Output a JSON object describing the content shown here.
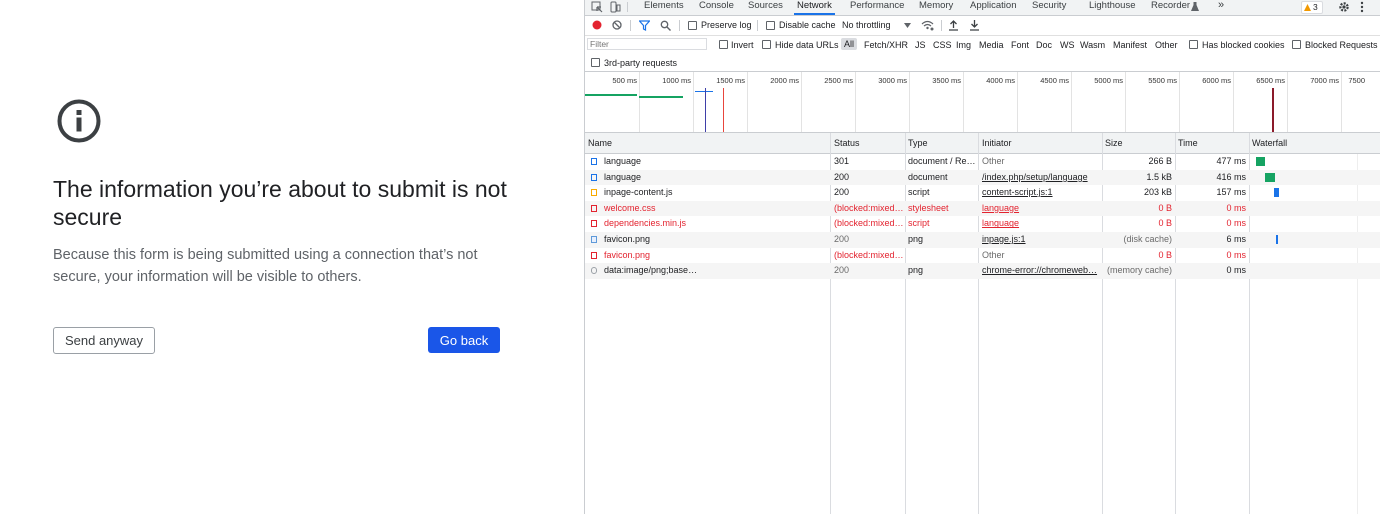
{
  "interstitial": {
    "heading": "The information you’re about to submit is not secure",
    "description": "Because this form is being submitted using a connection that’s not secure, your information will be visible to others.",
    "send_anyway_label": "Send anyway",
    "go_back_label": "Go back",
    "accent_color": "#1a56e8",
    "icon": "info-icon"
  },
  "devtools": {
    "tabs": [
      "Elements",
      "Console",
      "Sources",
      "Network",
      "Performance",
      "Memory",
      "Application",
      "Security",
      "Lighthouse",
      "Recorder"
    ],
    "active_tab": "Network",
    "more_tabs": "»",
    "warning_count": "3",
    "toolbar": {
      "preserve_log": "Preserve log",
      "disable_cache": "Disable cache",
      "throttling": "No throttling"
    },
    "filter": {
      "placeholder": "Filter",
      "invert": "Invert",
      "hide_data_urls": "Hide data URLs",
      "types": [
        "All",
        "Fetch/XHR",
        "JS",
        "CSS",
        "Img",
        "Media",
        "Font",
        "Doc",
        "WS",
        "Wasm",
        "Manifest",
        "Other"
      ],
      "has_blocked_cookies": "Has blocked cookies",
      "blocked_requests": "Blocked Requests",
      "third_party": "3rd-party requests"
    },
    "timeline_ticks": [
      "500 ms",
      "1000 ms",
      "1500 ms",
      "2000 ms",
      "2500 ms",
      "3000 ms",
      "3500 ms",
      "4000 ms",
      "4500 ms",
      "5000 ms",
      "5500 ms",
      "6000 ms",
      "6500 ms",
      "7000 ms",
      "7500"
    ],
    "columns": [
      "Name",
      "Status",
      "Type",
      "Initiator",
      "Size",
      "Time",
      "Waterfall"
    ],
    "requests": [
      {
        "name": "language",
        "status": "301",
        "type": "document / Re…",
        "initiator": "Other",
        "size": "266 B",
        "time": "477 ms"
      },
      {
        "name": "language",
        "status": "200",
        "type": "document",
        "initiator": "/index.php/setup/language",
        "size": "1.5 kB",
        "time": "416 ms"
      },
      {
        "name": "inpage-content.js",
        "status": "200",
        "type": "script",
        "initiator": "content-script.js:1",
        "size": "203 kB",
        "time": "157 ms"
      },
      {
        "name": "welcome.css",
        "status": "(blocked:mixed…",
        "type": "stylesheet",
        "initiator": "language",
        "size": "0 B",
        "time": "0 ms"
      },
      {
        "name": "dependencies.min.js",
        "status": "(blocked:mixed…",
        "type": "script",
        "initiator": "language",
        "size": "0 B",
        "time": "0 ms"
      },
      {
        "name": "favicon.png",
        "status": "200",
        "type": "png",
        "initiator": "inpage.js:1",
        "size": "(disk cache)",
        "time": "6 ms"
      },
      {
        "name": "favicon.png",
        "status": "(blocked:mixed…",
        "type": "",
        "initiator": "Other",
        "size": "0 B",
        "time": "0 ms"
      },
      {
        "name": "data:image/png;base…",
        "status": "200",
        "type": "png",
        "initiator": "chrome-error://chromeweb…",
        "size": "(memory cache)",
        "time": "0 ms"
      }
    ]
  }
}
